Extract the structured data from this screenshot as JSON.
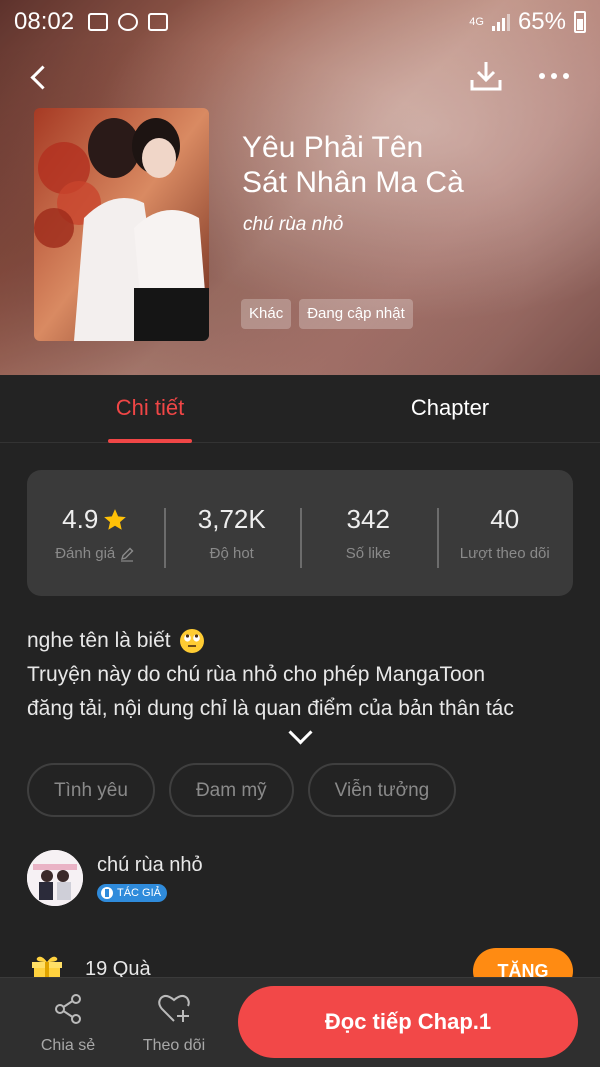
{
  "status_bar": {
    "time": "08:02",
    "network": "4G",
    "battery": "65%"
  },
  "book": {
    "title_line1": "Yêu Phải Tên",
    "title_line2": "Sát Nhân Ma Cà",
    "author": "chú rùa nhỏ",
    "tags": [
      "Khác",
      "Đang cập nhật"
    ]
  },
  "tabs": {
    "detail": "Chi tiết",
    "chapter": "Chapter"
  },
  "stats": [
    {
      "value": "4.9",
      "label": "Đánh giá"
    },
    {
      "value": "3,72K",
      "label": "Độ hot"
    },
    {
      "value": "342",
      "label": "Số like"
    },
    {
      "value": "40",
      "label": "Lượt theo dõi"
    }
  ],
  "description": {
    "line1": "nghe tên là biết",
    "line2": "Truyện này do chú rùa nhỏ cho phép MangaToon",
    "line3": "đăng tải, nội dung chỉ là quan điểm của bản thân tác"
  },
  "genres": [
    "Tình yêu",
    "Đam mỹ",
    "Viễn tưởng"
  ],
  "author_section": {
    "name": "chú rùa nhỏ",
    "badge": "TÁC GIẢ"
  },
  "gifts": {
    "count_text": "19 Quà",
    "give_label": "TẶNG"
  },
  "bottom_bar": {
    "share": "Chia sẻ",
    "follow": "Theo dõi",
    "read": "Đọc tiếp Chap.1"
  },
  "colors": {
    "accent": "#f24848",
    "gift_button": "#ff8b12",
    "badge": "#2f8bdb",
    "star": "#ffc107"
  }
}
